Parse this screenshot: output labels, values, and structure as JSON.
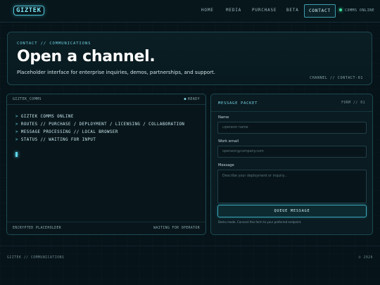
{
  "nav": {
    "logo": "GIZTEK",
    "links": [
      "HOME",
      "MEDIA",
      "PURCHASE",
      "BETA"
    ],
    "active": "CONTACT",
    "status": "COMMS ONLINE",
    "status_color": "#3fe0a0"
  },
  "hero": {
    "eyebrow": "CONTACT // COMMUNICATIONS",
    "title": "Open a channel.",
    "subtitle": "Placeholder interface for enterprise inquiries, demos, partnerships, and support.",
    "channel": "CHANNEL // CONTACT-01"
  },
  "terminal": {
    "title": "GIZTEK_COMMS",
    "ready": "READY",
    "lines": [
      "GIZTEK COMMS ONLINE",
      "ROUTES // PURCHASE / DEPLOYMENT / LICENSING / COLLABORATION",
      "MESSAGE PROCESSING // LOCAL BROWSER",
      "STATUS // WAITING FOR INPUT"
    ],
    "prompt": ">",
    "footer_left": "ENCRYPTED PLACEHOLDER",
    "footer_right": "WAITING FOR OPERATOR"
  },
  "form": {
    "title": "MESSAGE PACKET",
    "id": "FORM // 01",
    "name_label": "Name",
    "name_placeholder": "Operator name",
    "email_label": "Work email",
    "email_placeholder": "operator@company.com",
    "message_label": "Message",
    "message_placeholder": "Describe your deployment or inquiry...",
    "submit": "QUEUE MESSAGE",
    "note": "Demo mode. Connect this form to your preferred endpoint."
  },
  "footer": {
    "left": "GIZTEK // COMMUNICATIONS",
    "right": "© 2026"
  },
  "colors": {
    "accent": "#4fc8dc",
    "background": "#061318"
  }
}
